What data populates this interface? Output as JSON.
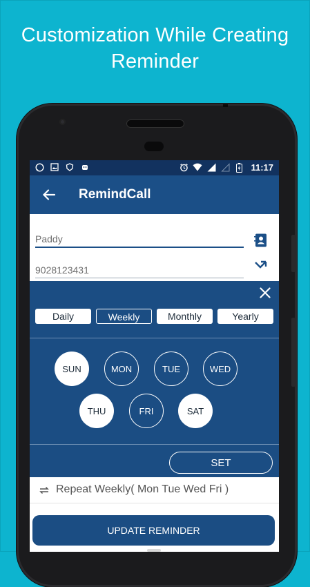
{
  "promo": {
    "title": "Customization While Creating\nReminder"
  },
  "status": {
    "time": "11:17"
  },
  "appbar": {
    "title": "RemindCall"
  },
  "form": {
    "name_value": "Paddy",
    "phone_value": "9028123431"
  },
  "frequency": {
    "options": [
      "Daily",
      "Weekly",
      "Monthly",
      "Yearly"
    ],
    "selected": "Weekly"
  },
  "days": [
    {
      "label": "SUN",
      "selected": true
    },
    {
      "label": "MON",
      "selected": false
    },
    {
      "label": "TUE",
      "selected": false
    },
    {
      "label": "WED",
      "selected": false
    },
    {
      "label": "THU",
      "selected": true
    },
    {
      "label": "FRI",
      "selected": false
    },
    {
      "label": "SAT",
      "selected": true
    }
  ],
  "set_label": "SET",
  "repeat_text": "Repeat Weekly( Mon Tue Wed Fri )",
  "update_label": "UPDATE REMINDER",
  "colors": {
    "background": "#0db4cf",
    "appbar": "#1b4f87",
    "sheet": "#1b4d83",
    "statusbar": "#12325f"
  }
}
